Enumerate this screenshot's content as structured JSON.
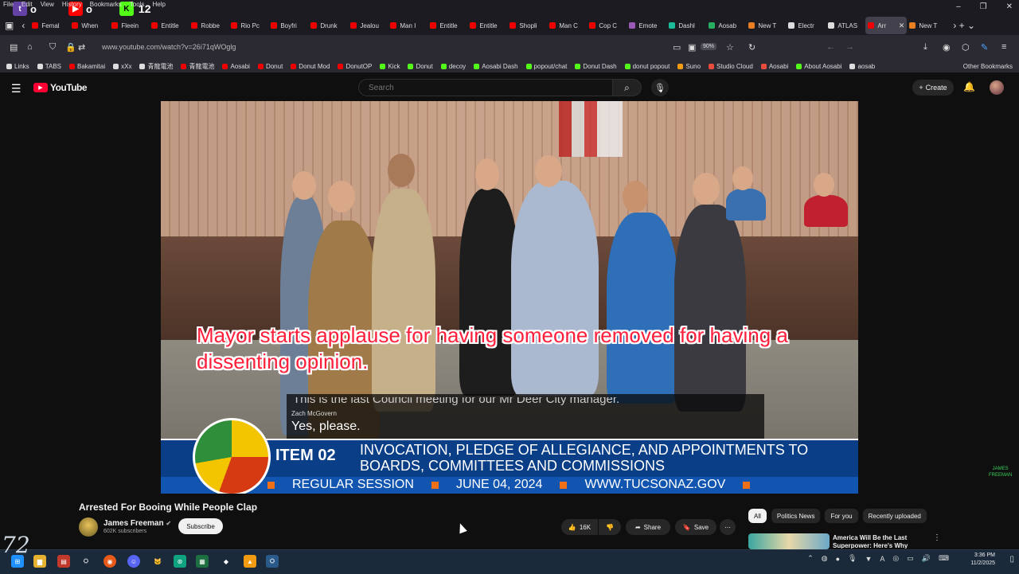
{
  "menu": [
    "File",
    "Edit",
    "View",
    "History",
    "Bookmarks",
    "Tools",
    "Help"
  ],
  "streamer_badges": {
    "count": "12"
  },
  "tabs": [
    {
      "label": "Femal",
      "color": "#e00"
    },
    {
      "label": "When",
      "color": "#e00"
    },
    {
      "label": "Fleein",
      "color": "#e00"
    },
    {
      "label": "Entitle",
      "color": "#e00"
    },
    {
      "label": "Robbe",
      "color": "#e00"
    },
    {
      "label": "Rio Pc",
      "color": "#e00"
    },
    {
      "label": "Boyfri",
      "color": "#e00"
    },
    {
      "label": "Drunk",
      "color": "#e00"
    },
    {
      "label": "Jealou",
      "color": "#e00"
    },
    {
      "label": "Man I",
      "color": "#e00"
    },
    {
      "label": "Entitle",
      "color": "#e00"
    },
    {
      "label": "Entitle",
      "color": "#e00"
    },
    {
      "label": "Shopli",
      "color": "#e00"
    },
    {
      "label": "Man C",
      "color": "#e00"
    },
    {
      "label": "Cop C",
      "color": "#e00"
    },
    {
      "label": "Emote",
      "color": "#9b59b6"
    },
    {
      "label": "Dashl",
      "color": "#1abc9c"
    },
    {
      "label": "Aosab",
      "color": "#27ae60"
    },
    {
      "label": "New T",
      "color": "#e67e22"
    },
    {
      "label": "Electr",
      "color": "#ddd"
    },
    {
      "label": "ATLAS",
      "color": "#ddd"
    },
    {
      "label": "Arr",
      "color": "#e00",
      "active": true
    },
    {
      "label": "New T",
      "color": "#e67e22"
    }
  ],
  "nav": {
    "url": "www.youtube.com/watch?v=26i71qWOglg",
    "zoom": "90%"
  },
  "bookmarks": [
    {
      "label": "Links",
      "color": "#ddd"
    },
    {
      "label": "TABS",
      "color": "#ddd"
    },
    {
      "label": "Bakamitai",
      "color": "#e00"
    },
    {
      "label": "xXx",
      "color": "#ddd"
    },
    {
      "label": "青龍電池",
      "color": "#ddd"
    },
    {
      "label": "青龍電池",
      "color": "#e00"
    },
    {
      "label": "Aosabi",
      "color": "#e00"
    },
    {
      "label": "Donut",
      "color": "#e00"
    },
    {
      "label": "Donut Mod",
      "color": "#e00"
    },
    {
      "label": "DonutOP",
      "color": "#e00"
    },
    {
      "label": "Kick",
      "color": "#53fc18"
    },
    {
      "label": "Donut",
      "color": "#53fc18"
    },
    {
      "label": "decoy",
      "color": "#53fc18"
    },
    {
      "label": "Aosabi Dash",
      "color": "#53fc18"
    },
    {
      "label": "popout/chat",
      "color": "#53fc18"
    },
    {
      "label": "Donut Dash",
      "color": "#53fc18"
    },
    {
      "label": "donut popout",
      "color": "#53fc18"
    },
    {
      "label": "Suno",
      "color": "#f39c12"
    },
    {
      "label": "Studio Cloud",
      "color": "#e74c3c"
    },
    {
      "label": "Aosabi",
      "color": "#e74c3c"
    },
    {
      "label": "About Aosabi",
      "color": "#53fc18"
    },
    {
      "label": "aosab",
      "color": "#ddd"
    }
  ],
  "other_bookmarks": "Other Bookmarks",
  "youtube": {
    "logo": "YouTube",
    "search_placeholder": "Search",
    "create_label": "Create"
  },
  "video": {
    "overlay_caption": "Mayor starts applause for having someone removed for having a dissenting opinion.",
    "cc_prev": "This is the last Council meeting for our Mr Deer City manager.",
    "cc_speaker": "Zach McGovern",
    "cc_line": "Yes, please.",
    "lower_third": {
      "item": "ITEM 02",
      "title": "INVOCATION, PLEDGE OF ALLEGIANCE, AND APPOINTMENTS TO BOARDS, COMMITTEES AND COMMISSIONS",
      "session": "REGULAR SESSION",
      "date": "JUNE 04, 2024",
      "site": "WWW.TUCSONAZ.GOV"
    },
    "watermark": "JAMES\nFREEMAN"
  },
  "meta": {
    "title": "Arrested For Booing While People Clap",
    "channel": "James Freeman",
    "subscribers": "602K subscribers",
    "subscribe_label": "Subscribe",
    "likes": "16K",
    "share_label": "Share",
    "save_label": "Save"
  },
  "chips": [
    "All",
    "Politics News",
    "For you",
    "Recently uploaded"
  ],
  "recommendation": {
    "title": "America Will Be the Last Superpower: Here's Why"
  },
  "taskbar": {
    "time": "3:36 PM",
    "date": "11/2/2025",
    "logo": "72"
  }
}
